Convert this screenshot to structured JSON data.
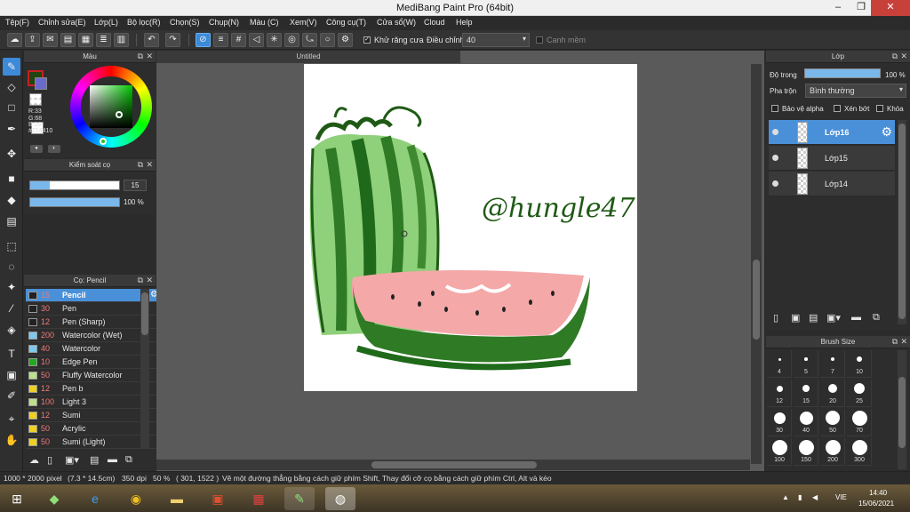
{
  "window": {
    "title": "MediBang Paint Pro (64bit)",
    "minimize": "–",
    "maximize": "❐",
    "close": "✕"
  },
  "menu": [
    "Tệp(F)",
    "Chỉnh sửa(E)",
    "Lớp(L)",
    "Bộ lọc(R)",
    "Chọn(S)",
    "Chụp(N)",
    "Màu (C)",
    "Xem(V)",
    "Công cụ(T)",
    "Cửa sổ(W)",
    "Cloud",
    "Help"
  ],
  "toolbar": {
    "antialias_label": "Khử răng cưa",
    "correction_label": "Điều chỉnh",
    "correction_value": "40",
    "edge_label": "Canh mềm"
  },
  "color_panel": {
    "title": "Màu",
    "rgb_r": "R:33",
    "rgb_g": "G:68",
    "rgb_b": "B:16",
    "hex": "#214410",
    "primary_color": "#214410",
    "secondary_color": "#ffffff"
  },
  "brush_control": {
    "title": "Kiểm soát cọ",
    "size": "15",
    "opacity": "100 %",
    "size_fraction": 0.22,
    "opacity_fraction": 1.0
  },
  "brush_panel": {
    "title": "Cọ: Pencil",
    "brushes": [
      {
        "size": "15",
        "name": "Pencil",
        "color": "#222222"
      },
      {
        "size": "30",
        "name": "Pen",
        "color": "#222222"
      },
      {
        "size": "12",
        "name": "Pen (Sharp)",
        "color": "#222222"
      },
      {
        "size": "200",
        "name": "Watercolor (Wet)",
        "color": "#7ec8f0"
      },
      {
        "size": "40",
        "name": "Watercolor",
        "color": "#7ec8f0"
      },
      {
        "size": "10",
        "name": "Edge Pen",
        "color": "#22aa22"
      },
      {
        "size": "50",
        "name": "Fluffy Watercolor",
        "color": "#bde08a"
      },
      {
        "size": "12",
        "name": "Pen b",
        "color": "#f0d020"
      },
      {
        "size": "100",
        "name": "Light 3",
        "color": "#bde08a"
      },
      {
        "size": "12",
        "name": "Sumi",
        "color": "#f0d020"
      },
      {
        "size": "50",
        "name": "Acrylic",
        "color": "#f0d020"
      },
      {
        "size": "50",
        "name": "Sumi (Light)",
        "color": "#f0d020"
      }
    ]
  },
  "document": {
    "tab": "Untitled",
    "signature": "@hungle47"
  },
  "layers_panel": {
    "title": "Lớp",
    "opacity_label": "Độ trong",
    "opacity_value": "100 %",
    "blend_label": "Pha trộn",
    "blend_value": "Bình thường",
    "protect_alpha": "Bảo vệ alpha",
    "clipping": "Xén bớt",
    "lock": "Khóa",
    "layers": [
      {
        "name": "Lớp16",
        "selected": true
      },
      {
        "name": "Lớp15",
        "selected": false
      },
      {
        "name": "Lớp14",
        "selected": false
      }
    ]
  },
  "brush_size_panel": {
    "title": "Brush Size",
    "sizes": [
      "4",
      "5",
      "7",
      "10",
      "12",
      "15",
      "20",
      "25",
      "30",
      "40",
      "50",
      "70",
      "100",
      "150",
      "200",
      "300"
    ]
  },
  "status": {
    "dimensions": "1000 * 2000 pixel",
    "physical": "(7.3 * 14.5cm)",
    "dpi": "350 dpi",
    "zoom": "50 %",
    "coords": "( 301, 1522 )",
    "hint": "Vẽ một đường thẳng bằng cách giữ phím Shift, Thay đổi cỡ cọ bằng cách giữ phím Ctrl, Alt và kéo"
  },
  "taskbar": {
    "lang": "VIE",
    "time": "14:40",
    "date": "15/06/2021"
  },
  "colors": {
    "accent": "#3c8ad8",
    "panel": "#2d2d2d",
    "watermelon_dark": "#1f6a1a",
    "watermelon_light": "#8fd07a",
    "flesh": "#f4a8a8"
  }
}
